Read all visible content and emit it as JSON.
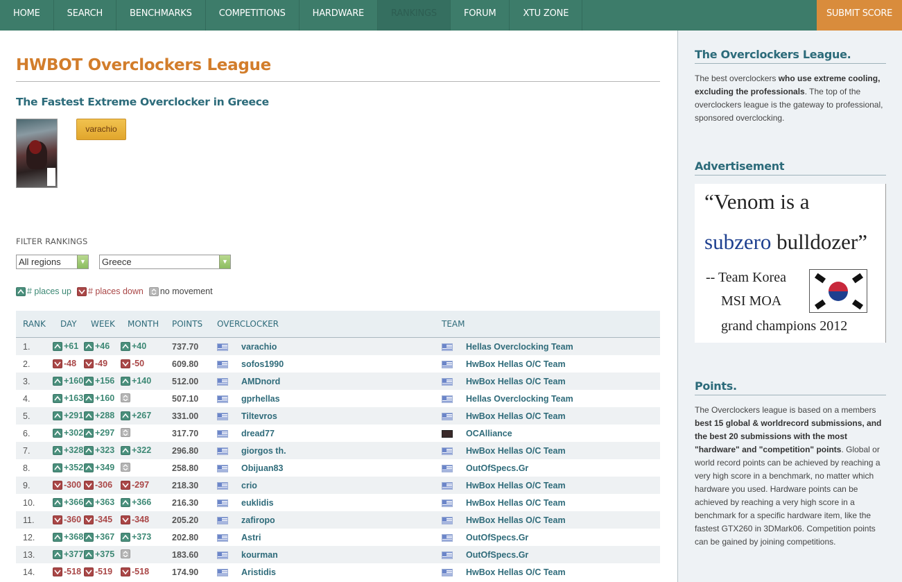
{
  "nav": {
    "items": [
      "HOME",
      "SEARCH",
      "BENCHMARKS",
      "COMPETITIONS",
      "HARDWARE",
      "RANKINGS",
      "FORUM",
      "XTU ZONE"
    ],
    "active": "RANKINGS",
    "submit": "SUBMIT SCORE"
  },
  "main": {
    "title": "HWBOT Overclockers League",
    "subtitle": "The Fastest Extreme Overclocker in Greece",
    "top_user": "varachio",
    "filter_label": "FILTER RANKINGS",
    "region_select": "All regions",
    "country_select": "Greece",
    "legend": {
      "up": "# places up",
      "down": "# places down",
      "same": "no movement"
    }
  },
  "table": {
    "headers": {
      "rank": "RANK",
      "day": "DAY",
      "week": "WEEK",
      "month": "MONTH",
      "points": "POINTS",
      "overclocker": "OVERCLOCKER",
      "team": "TEAM"
    },
    "rows": [
      {
        "rank": "1.",
        "day": {
          "dir": "up",
          "v": "+61"
        },
        "week": {
          "dir": "up",
          "v": "+46"
        },
        "month": {
          "dir": "up",
          "v": "+40"
        },
        "points": "737.70",
        "name": "varachio",
        "team": "Hellas Overclocking Team",
        "team_flag": "gr"
      },
      {
        "rank": "2.",
        "day": {
          "dir": "down",
          "v": "-48"
        },
        "week": {
          "dir": "down",
          "v": "-49"
        },
        "month": {
          "dir": "down",
          "v": "-50"
        },
        "points": "609.80",
        "name": "sofos1990",
        "team": "HwBox Hellas O/C Team",
        "team_flag": "gr"
      },
      {
        "rank": "3.",
        "day": {
          "dir": "up",
          "v": "+160"
        },
        "week": {
          "dir": "up",
          "v": "+156"
        },
        "month": {
          "dir": "up",
          "v": "+140"
        },
        "points": "512.00",
        "name": "AMDnord",
        "team": "HwBox Hellas O/C Team",
        "team_flag": "gr"
      },
      {
        "rank": "4.",
        "day": {
          "dir": "up",
          "v": "+163"
        },
        "week": {
          "dir": "up",
          "v": "+160"
        },
        "month": {
          "dir": "same",
          "v": ""
        },
        "points": "507.10",
        "name": "gprhellas",
        "team": "Hellas Overclocking Team",
        "team_flag": "gr"
      },
      {
        "rank": "5.",
        "day": {
          "dir": "up",
          "v": "+291"
        },
        "week": {
          "dir": "up",
          "v": "+288"
        },
        "month": {
          "dir": "up",
          "v": "+267"
        },
        "points": "331.00",
        "name": "Tiltevros",
        "team": "HwBox Hellas O/C Team",
        "team_flag": "gr"
      },
      {
        "rank": "6.",
        "day": {
          "dir": "up",
          "v": "+302"
        },
        "week": {
          "dir": "up",
          "v": "+297"
        },
        "month": {
          "dir": "same",
          "v": ""
        },
        "points": "317.70",
        "name": "dread77",
        "team": "OCAlliance",
        "team_flag": "oca"
      },
      {
        "rank": "7.",
        "day": {
          "dir": "up",
          "v": "+328"
        },
        "week": {
          "dir": "up",
          "v": "+323"
        },
        "month": {
          "dir": "up",
          "v": "+322"
        },
        "points": "296.80",
        "name": "giorgos th.",
        "team": "HwBox Hellas O/C Team",
        "team_flag": "gr"
      },
      {
        "rank": "8.",
        "day": {
          "dir": "up",
          "v": "+352"
        },
        "week": {
          "dir": "up",
          "v": "+349"
        },
        "month": {
          "dir": "same",
          "v": ""
        },
        "points": "258.80",
        "name": "Obijuan83",
        "team": "OutOfSpecs.Gr",
        "team_flag": "gr"
      },
      {
        "rank": "9.",
        "day": {
          "dir": "down",
          "v": "-300"
        },
        "week": {
          "dir": "down",
          "v": "-306"
        },
        "month": {
          "dir": "down",
          "v": "-297"
        },
        "points": "218.30",
        "name": "crio",
        "team": "HwBox Hellas O/C Team",
        "team_flag": "gr"
      },
      {
        "rank": "10.",
        "day": {
          "dir": "up",
          "v": "+366"
        },
        "week": {
          "dir": "up",
          "v": "+363"
        },
        "month": {
          "dir": "up",
          "v": "+366"
        },
        "points": "216.30",
        "name": "euklidis",
        "team": "HwBox Hellas O/C Team",
        "team_flag": "gr"
      },
      {
        "rank": "11.",
        "day": {
          "dir": "down",
          "v": "-360"
        },
        "week": {
          "dir": "down",
          "v": "-345"
        },
        "month": {
          "dir": "down",
          "v": "-348"
        },
        "points": "205.20",
        "name": "zafiropo",
        "team": "HwBox Hellas O/C Team",
        "team_flag": "gr"
      },
      {
        "rank": "12.",
        "day": {
          "dir": "up",
          "v": "+368"
        },
        "week": {
          "dir": "up",
          "v": "+367"
        },
        "month": {
          "dir": "up",
          "v": "+373"
        },
        "points": "202.80",
        "name": "Astri",
        "team": "OutOfSpecs.Gr",
        "team_flag": "gr"
      },
      {
        "rank": "13.",
        "day": {
          "dir": "up",
          "v": "+377"
        },
        "week": {
          "dir": "up",
          "v": "+375"
        },
        "month": {
          "dir": "same",
          "v": ""
        },
        "points": "183.60",
        "name": "kourman",
        "team": "OutOfSpecs.Gr",
        "team_flag": "gr"
      },
      {
        "rank": "14.",
        "day": {
          "dir": "down",
          "v": "-518"
        },
        "week": {
          "dir": "down",
          "v": "-519"
        },
        "month": {
          "dir": "down",
          "v": "-518"
        },
        "points": "174.90",
        "name": "Aristidis",
        "team": "HwBox Hellas O/C Team",
        "team_flag": "gr"
      }
    ]
  },
  "sidebar": {
    "league_title": "The Overclockers League.",
    "league_text_1": "The best overclockers ",
    "league_text_bold": "who use extreme cooling, excluding the professionals",
    "league_text_2": ". The top of the overclockers league is the gateway to professional, sponsored overclocking.",
    "ad_title": "Advertisement",
    "ad": {
      "line1": "“Venom is a",
      "line2_blue": "subzero",
      "line2_rest": " bulldozer”",
      "line3": "-- Team Korea",
      "line4": "MSI MOA",
      "line5": "grand champions 2012"
    },
    "points_title": "Points.",
    "points_text_1": "The Overclockers league is based on a members ",
    "points_text_bold": "best 15 global & worldrecord submissions, and the best 20 submissions with the most \"hardware\" and \"competition\" points",
    "points_text_2": ". Global or world record points can be achieved by reaching a very high score in a benchmark, no matter which hardware you used. Hardware points can be achieved by reaching a very high score in a benchmark for a specific hardware item, like the fastest GTX260 in 3DMark06. Competition points can be gained by joining competitions."
  },
  "colors": {
    "nav_bg": "#3d7c6a",
    "submit_bg": "#d98c3c",
    "title": "#d27d2b",
    "link": "#2f6b7a",
    "up": "#4a8f7c",
    "down": "#a94747"
  }
}
